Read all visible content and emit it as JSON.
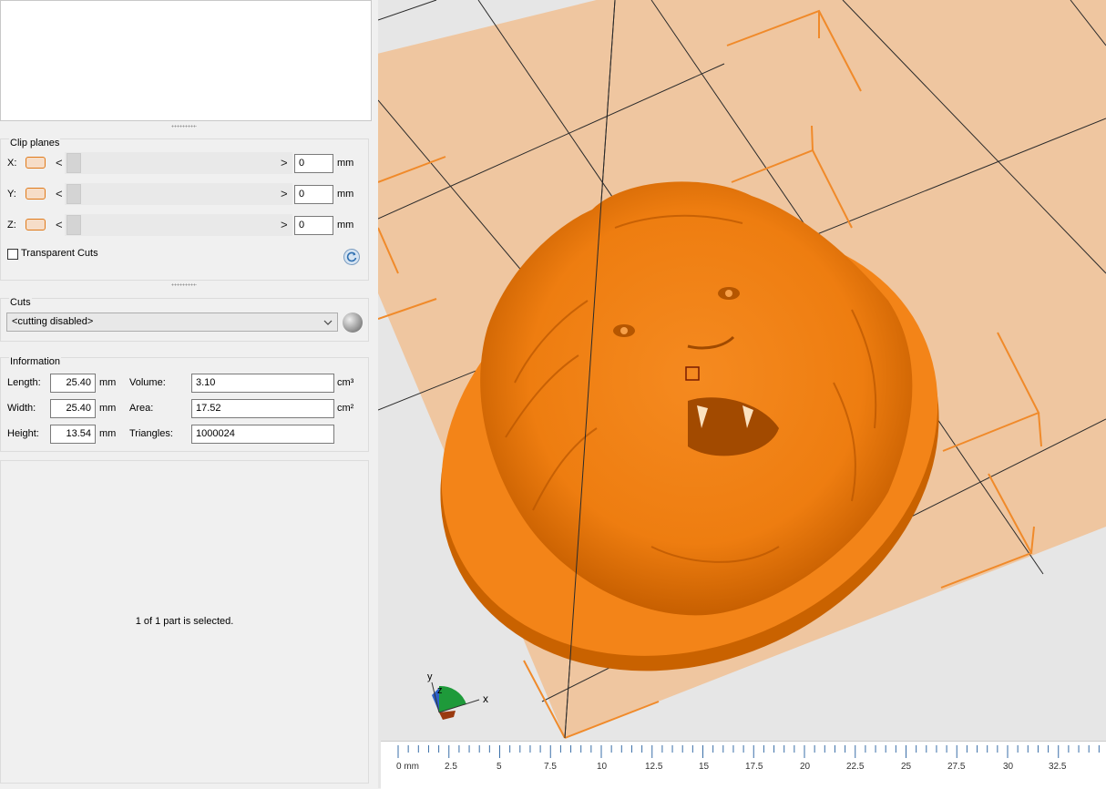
{
  "clip_planes": {
    "title": "Clip planes",
    "rows": [
      {
        "axis": "X:",
        "value": "0",
        "unit": "mm"
      },
      {
        "axis": "Y:",
        "value": "0",
        "unit": "mm"
      },
      {
        "axis": "Z:",
        "value": "0",
        "unit": "mm"
      }
    ],
    "left_arrow": "<",
    "right_arrow": ">",
    "transparent_cuts_label": "Transparent Cuts"
  },
  "cuts": {
    "title": "Cuts",
    "selected": "<cutting disabled>"
  },
  "information": {
    "title": "Information",
    "length": {
      "label": "Length:",
      "value": "25.40",
      "unit": "mm"
    },
    "width": {
      "label": "Width:",
      "value": "25.40",
      "unit": "mm"
    },
    "height": {
      "label": "Height:",
      "value": "13.54",
      "unit": "mm"
    },
    "volume": {
      "label": "Volume:",
      "value": "3.10",
      "unit": "cm³"
    },
    "area": {
      "label": "Area:",
      "value": "17.52",
      "unit": "cm²"
    },
    "triangles": {
      "label": "Triangles:",
      "value": "1000024"
    }
  },
  "selection_status": "1 of 1 part is selected.",
  "axes": {
    "x": "x",
    "y": "y",
    "z": "z"
  },
  "ruler": {
    "labels": [
      "0 mm",
      "2.5",
      "5",
      "7.5",
      "10",
      "12.5",
      "15",
      "17.5",
      "20",
      "22.5",
      "25",
      "27.5",
      "30",
      "32.5"
    ]
  },
  "colors": {
    "model": "#f07f0e",
    "build_plate": "#efc6a0",
    "accent": "#e07a1a"
  }
}
